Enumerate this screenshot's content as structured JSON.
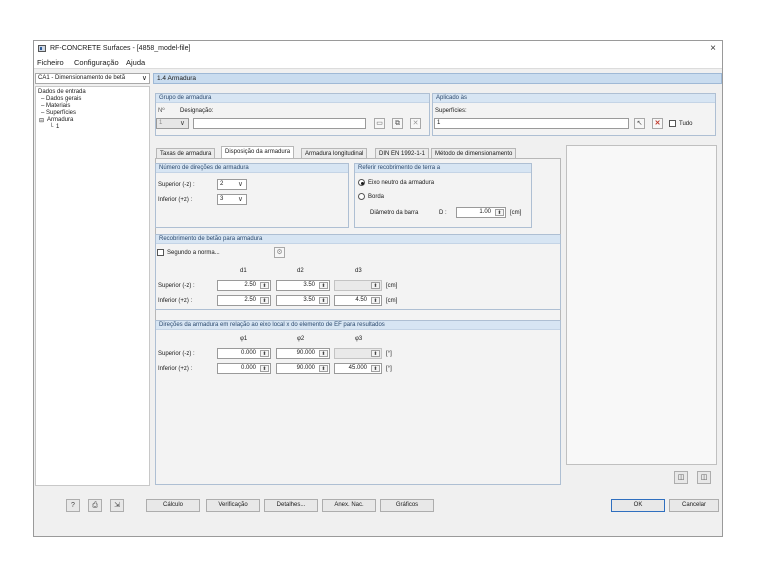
{
  "window": {
    "title": "RF-CONCRETE Surfaces - [4858_model-file]",
    "close_glyph": "×"
  },
  "menu": [
    "Ficheiro",
    "Configuração",
    "Ajuda"
  ],
  "case_select": {
    "value": "CA1 - Dimensionamento de betã",
    "chevron": "∨"
  },
  "tree": {
    "root": "Dados de entrada",
    "items": [
      "Dados gerais",
      "Materiais",
      "Superfícies",
      "Armadura",
      "1"
    ],
    "expander": "⊟"
  },
  "header": {
    "title": "1.4 Armadura"
  },
  "group_armadura": {
    "title": "Grupo de armadura",
    "no_label": "Nº",
    "designacao_label": "Designação:",
    "no_value": "1",
    "designacao_value": ""
  },
  "aplicado": {
    "title": "Aplicado às",
    "superficies_label": "Superfícies:",
    "superficies_value": "1",
    "tudo_label": "Tudo",
    "tudo_checked": false
  },
  "tabs": [
    "Taxas de armadura",
    "Disposição da armadura",
    "Armadura longitudinal",
    "DIN EN 1992-1-1",
    "Método de dimensionamento"
  ],
  "active_tab": 1,
  "directions": {
    "title": "Número de direções de armadura",
    "superior_label": "Superior (-z) :",
    "superior_value": "2",
    "inferior_label": "Inferior (+z) :",
    "inferior_value": "3"
  },
  "recobrimento_ref": {
    "title": "Referir recobrimento de terra a",
    "option1": "Eixo neutro da armadura",
    "option2": "Borda",
    "selected": 0,
    "diametro_label": "Diâmetro da barra",
    "d_label": "D :",
    "d_value": "1.00",
    "unit": "[cm]"
  },
  "recobrimento": {
    "title": "Recobrimento de betão para armadura",
    "segundo_label": "Segundo a norma...",
    "segundo_checked": false,
    "col_headers": [
      "d1",
      "d2",
      "d3"
    ],
    "superior_label": "Superior (-z) :",
    "inferior_label": "Inferior (+z) :",
    "superior_values": [
      "2.50",
      "3.50",
      ""
    ],
    "inferior_values": [
      "2.50",
      "3.50",
      "4.50"
    ],
    "unit": "[cm]"
  },
  "direcoes": {
    "title": "Direções da armadura em relação ao eixo local x do elemento de EF para resultados",
    "col_headers": [
      "φ1",
      "φ2",
      "φ3"
    ],
    "superior_label": "Superior (-z) :",
    "inferior_label": "Inferior (+z) :",
    "superior_values": [
      "0.000",
      "90.000",
      ""
    ],
    "inferior_values": [
      "0.000",
      "90.000",
      "45.000"
    ],
    "unit": "[°]"
  },
  "bottom_buttons": {
    "calculo": "Cálculo",
    "verificacao": "Verificação",
    "detalhes": "Detalhes...",
    "anex": "Anex. Nac.",
    "graficos": "Gráficos",
    "ok": "OK",
    "cancelar": "Cancelar"
  },
  "icons": {
    "help": "help-icon",
    "print": "print-icon",
    "export": "export-icon"
  }
}
